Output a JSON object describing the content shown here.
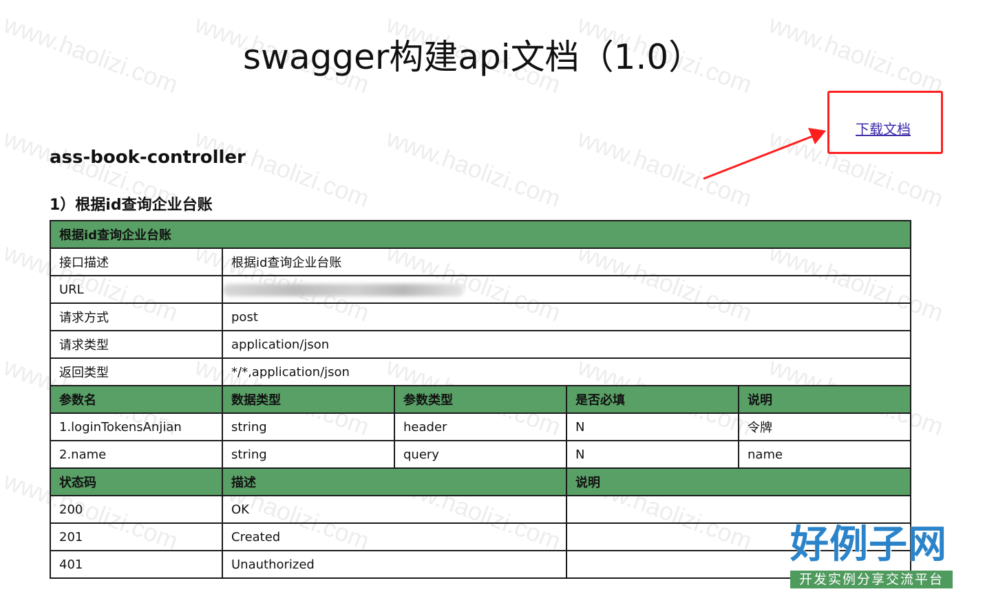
{
  "watermark": {
    "text": "www.haolizi.com"
  },
  "header": {
    "title": "swagger构建api文档（1.0）"
  },
  "download": {
    "label": "下载文档"
  },
  "section": {
    "title": "ass-book-controller"
  },
  "operation": {
    "title": "1）根据id查询企业台账",
    "table_header": "根据id查询企业台账",
    "info": [
      {
        "label": "接口描述",
        "value": "根据id查询企业台账"
      },
      {
        "label": "URL",
        "value": ""
      },
      {
        "label": "请求方式",
        "value": "post"
      },
      {
        "label": "请求类型",
        "value": "application/json"
      },
      {
        "label": "返回类型",
        "value": "*/*,application/json"
      }
    ],
    "param_headers": [
      "参数名",
      "数据类型",
      "参数类型",
      "是否必填",
      "说明"
    ],
    "params": [
      [
        "1.loginTokensAnjian",
        "string",
        "header",
        "N",
        "令牌"
      ],
      [
        "2.name",
        "string",
        "query",
        "N",
        "name"
      ]
    ],
    "status_headers": [
      "状态码",
      "描述",
      "说明"
    ],
    "statuses": [
      [
        "200",
        "OK",
        ""
      ],
      [
        "201",
        "Created",
        ""
      ],
      [
        "401",
        "Unauthorized",
        ""
      ]
    ]
  },
  "colors": {
    "header_green": "#59a066",
    "highlight_red": "#ff1e1e",
    "link": "#3a2ca8",
    "logo_blue": "#2b83c9"
  },
  "logo": {
    "main": "好例子网",
    "sub": "开发实例分享交流平台"
  }
}
